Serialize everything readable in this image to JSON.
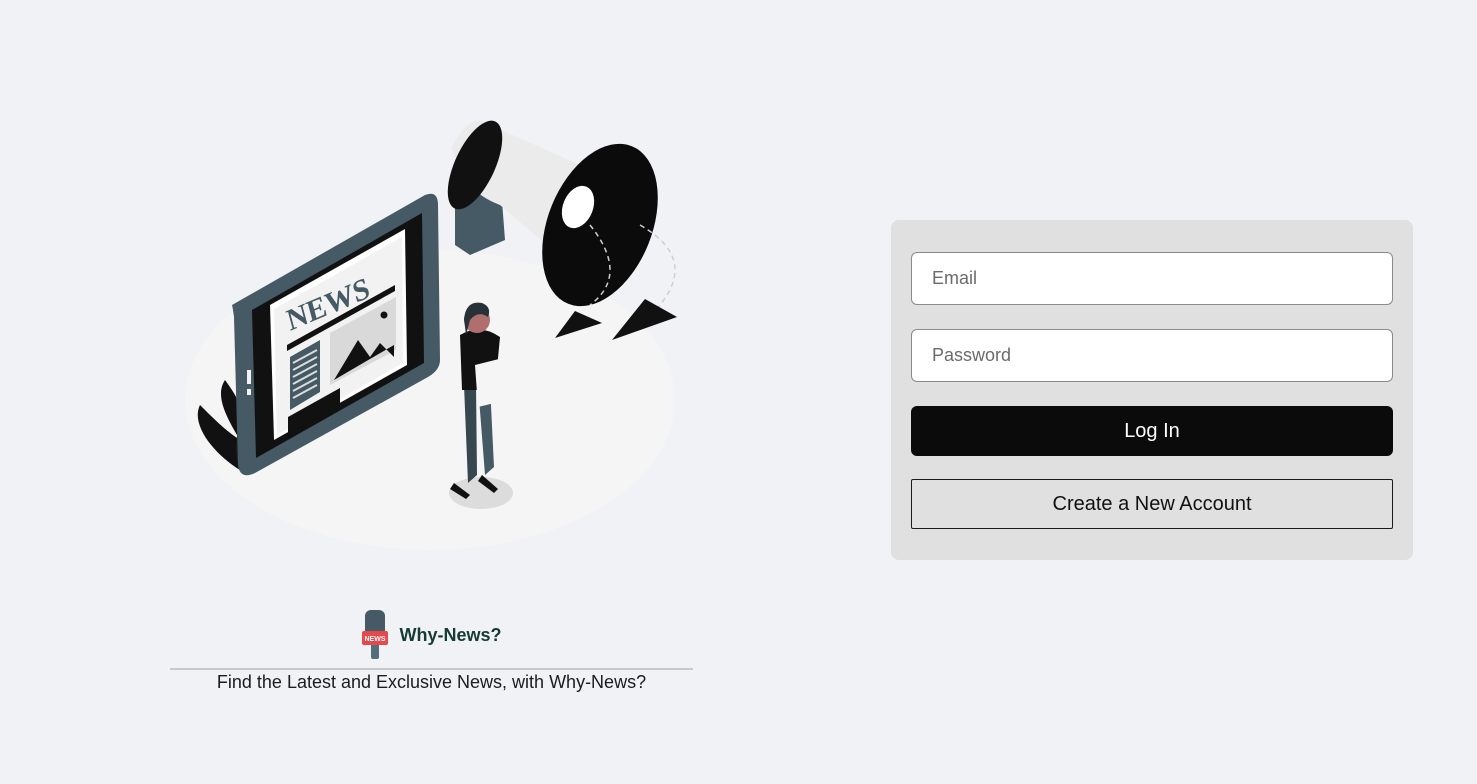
{
  "brand": {
    "name": "Why-News?",
    "tagline": "Find the Latest and Exclusive News, with Why-News?",
    "logo_icon": "news-microphone-icon",
    "logo_badge_text": "NEWS",
    "colors": {
      "name": "#163b36",
      "badge": "#e5484d"
    }
  },
  "illustration": {
    "icon": "news-announcement-illustration",
    "headline_text": "NEWS"
  },
  "login_form": {
    "email": {
      "placeholder": "Email",
      "value": ""
    },
    "password": {
      "placeholder": "Password",
      "value": ""
    },
    "login_label": "Log In",
    "create_account_label": "Create a New Account"
  },
  "colors": {
    "page_background": "#f0f2f5",
    "card_background": "#e0e0e0",
    "primary_button": "#0b0b0b",
    "primary_button_text": "#ffffff"
  }
}
